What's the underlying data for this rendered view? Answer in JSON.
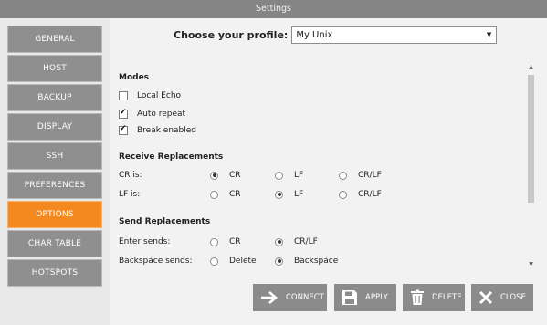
{
  "window": {
    "title": "Settings"
  },
  "sidebar": {
    "items": [
      {
        "label": "GENERAL",
        "active": false
      },
      {
        "label": "HOST",
        "active": false
      },
      {
        "label": "BACKUP",
        "active": false
      },
      {
        "label": "DISPLAY",
        "active": false
      },
      {
        "label": "SSH",
        "active": false
      },
      {
        "label": "PREFERENCES",
        "active": false
      },
      {
        "label": "OPTIONS",
        "active": true
      },
      {
        "label": "CHAR TABLE",
        "active": false
      },
      {
        "label": "HOTSPOTS",
        "active": false
      }
    ]
  },
  "profile": {
    "label": "Choose your profile:",
    "selected": "My Unix"
  },
  "modes": {
    "title": "Modes",
    "options": [
      {
        "label": "Local Echo",
        "checked": false
      },
      {
        "label": "Auto repeat",
        "checked": true
      },
      {
        "label": "Break enabled",
        "checked": true
      }
    ]
  },
  "receive": {
    "title": "Receive Replacements",
    "rows": [
      {
        "label": "CR is:",
        "options": [
          "CR",
          "LF",
          "CR/LF"
        ],
        "selected": "CR"
      },
      {
        "label": "LF is:",
        "options": [
          "CR",
          "LF",
          "CR/LF"
        ],
        "selected": "LF"
      }
    ]
  },
  "send": {
    "title": "Send Replacements",
    "rows": [
      {
        "label": "Enter sends:",
        "options": [
          "CR",
          "CR/LF"
        ],
        "selected": "CR/LF"
      },
      {
        "label": "Backspace sends:",
        "options": [
          "Delete",
          "Backspace"
        ],
        "selected": "Backspace"
      }
    ]
  },
  "buttons": {
    "connect": "CONNECT",
    "apply": "APPLY",
    "delete": "DELETE",
    "close": "CLOSE"
  },
  "colors": {
    "accent": "#f48a1f",
    "nav_bg": "#8f8f8f",
    "titlebar": "#858585",
    "button": "#8b8b8b"
  },
  "icons": [
    "arrow-right-icon",
    "floppy-disk-icon",
    "trash-icon",
    "close-x-icon",
    "chevron-down-icon"
  ]
}
